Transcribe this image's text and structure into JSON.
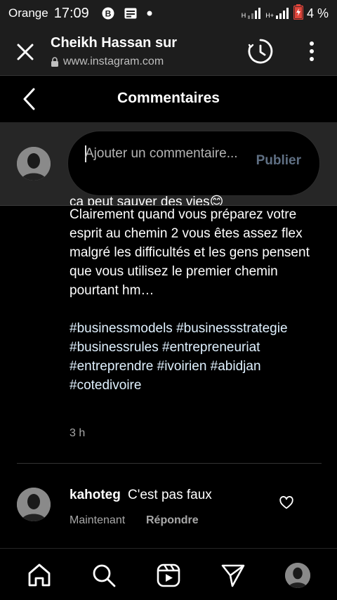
{
  "status_bar": {
    "carrier": "Orange",
    "time": "17:09",
    "network_1": "H",
    "network_2": "H+",
    "battery": "4 %"
  },
  "browser": {
    "title": "Cheikh Hassan sur",
    "url": "www.instagram.com"
  },
  "header": {
    "title": "Commentaires"
  },
  "composer": {
    "placeholder": "Ajouter un commentaire...",
    "publish_label": "Publier"
  },
  "caption": {
    "top_line": "ça peut sauver des vies😊",
    "body": "Clairement quand vous préparez votre esprit au chemin 2 vous êtes assez flex malgré les difficultés et les gens pensent que vous utilisez le premier chemin pourtant hm…",
    "hashtags": "#businessmodels #businessstrategie #businessrules #entrepreneuriat #entreprendre #ivoirien #abidjan #cotedivoire",
    "time": "3 h"
  },
  "comments": [
    {
      "username": "kahoteg",
      "text": "C'est pas faux",
      "time": "Maintenant",
      "reply_label": "Répondre"
    }
  ],
  "icons": {
    "close": "close-icon",
    "history": "history-icon",
    "menu": "more-vertical-icon",
    "back": "chevron-left-icon",
    "like": "heart-icon",
    "home": "home-icon",
    "search": "search-icon",
    "reels": "reels-icon",
    "direct": "send-icon"
  },
  "colors": {
    "background": "#000000",
    "composer_background": "#262626",
    "publish_disabled": "#5f6f83",
    "hashtag": "#e0f1ff"
  }
}
